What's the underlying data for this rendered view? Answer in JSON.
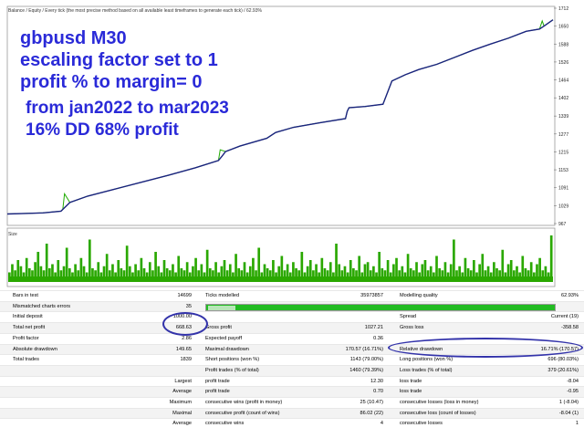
{
  "legend": "Balance / Equity / Every tick (the most precise method based on all available least timeframes to generate each tick) / 62.93%",
  "overlay": {
    "line1": "gbpusd M30",
    "line2": "escaling factor set to 1",
    "line3": "profit % to margin=  0",
    "line4": "from jan2022 to mar2023",
    "line5": "16% DD 68% profit"
  },
  "chart_data": [
    {
      "type": "line",
      "title": "",
      "series": [
        {
          "name": "Balance",
          "color": "#1a237e",
          "x": [
            0,
            20,
            40,
            60,
            62,
            70,
            90,
            120,
            150,
            180,
            210,
            236,
            240,
            244,
            260,
            290,
            300,
            320,
            350,
            378,
            380,
            382,
            400,
            420,
            425,
            430,
            445,
            460,
            480,
            500,
            520,
            540,
            560,
            580,
            595,
            600,
            610
          ],
          "y": [
            1000,
            1002,
            1004,
            1010,
            1016,
            1040,
            1062,
            1086,
            1110,
            1134,
            1160,
            1185,
            1200,
            1216,
            1235,
            1262,
            1282,
            1300,
            1316,
            1330,
            1355,
            1368,
            1372,
            1380,
            1420,
            1460,
            1482,
            1500,
            1518,
            1542,
            1566,
            1588,
            1608,
            1632,
            1640,
            1650,
            1672
          ]
        },
        {
          "name": "Equity",
          "color": "#1faa00",
          "x": [
            0,
            20,
            40,
            60,
            62,
            64,
            70,
            90,
            120,
            150,
            180,
            210,
            236,
            238,
            244,
            260,
            290,
            300,
            320,
            350,
            378,
            380,
            382,
            400,
            420,
            425,
            430,
            445,
            460,
            480,
            500,
            520,
            540,
            560,
            580,
            595,
            598,
            600,
            610
          ],
          "y": [
            1000,
            1002,
            1004,
            1010,
            1016,
            1070,
            1040,
            1062,
            1086,
            1110,
            1134,
            1160,
            1185,
            1222,
            1216,
            1235,
            1262,
            1282,
            1300,
            1316,
            1330,
            1355,
            1368,
            1372,
            1380,
            1420,
            1460,
            1482,
            1500,
            1518,
            1542,
            1566,
            1588,
            1608,
            1632,
            1640,
            1668,
            1650,
            1672
          ]
        }
      ],
      "y_ticks": [
        "1712",
        "1650",
        "1588",
        "1526",
        "1464",
        "1402",
        "1339",
        "1277",
        "1215",
        "1153",
        "1091",
        "1029",
        "967"
      ],
      "ylim": [
        967,
        1712
      ],
      "grid": false
    },
    {
      "type": "bar",
      "title": "Size",
      "color": "#2aa800",
      "values": [
        2,
        6,
        3,
        8,
        5,
        2,
        9,
        4,
        3,
        7,
        12,
        5,
        3,
        16,
        4,
        6,
        2,
        8,
        3,
        5,
        14,
        4,
        2,
        6,
        3,
        9,
        5,
        2,
        18,
        4,
        3,
        7,
        2,
        5,
        11,
        3,
        6,
        2,
        8,
        4,
        3,
        15,
        5,
        2,
        6,
        3,
        9,
        4,
        2,
        7,
        3,
        12,
        5,
        2,
        8,
        4,
        3,
        6,
        2,
        10,
        4,
        3,
        7,
        2,
        5,
        9,
        3,
        6,
        2,
        13,
        4,
        3,
        7,
        2,
        5,
        8,
        3,
        6,
        2,
        11,
        4,
        3,
        7,
        2,
        5,
        9,
        3,
        14,
        2,
        6,
        4,
        3,
        8,
        2,
        5,
        10,
        3,
        6,
        2,
        7,
        4,
        3,
        12,
        2,
        5,
        8,
        3,
        6,
        2,
        9,
        4,
        3,
        7,
        2,
        16,
        6,
        3,
        5,
        2,
        8,
        4,
        3,
        10,
        2,
        6,
        7,
        3,
        5,
        2,
        12,
        4,
        3,
        8,
        2,
        6,
        9,
        3,
        5,
        2,
        11,
        4,
        3,
        7,
        2,
        6,
        8,
        3,
        5,
        2,
        10,
        4,
        3,
        7,
        2,
        6,
        18,
        3,
        5,
        2,
        9,
        4,
        3,
        8,
        2,
        6,
        11,
        3,
        5,
        2,
        7,
        4,
        3,
        13,
        2,
        6,
        8,
        3,
        5,
        2,
        10,
        4,
        3,
        7,
        2,
        6,
        9,
        3,
        5,
        2,
        20
      ]
    }
  ],
  "report": {
    "bars_label": "Bars in test",
    "bars_value": "14699",
    "ticks_label": "Ticks modelled",
    "ticks_value": "35973857",
    "mq_label": "Modelling quality",
    "mq_value": "62.93%",
    "mismatch_label": "Mismatched charts errors",
    "mismatch_value": "35",
    "deposit_label": "Initial deposit",
    "deposit_value": "1000.00",
    "spread_label": "Spread",
    "spread_value": "Current (19)",
    "netprofit_label": "Total net profit",
    "netprofit_value": "668.63",
    "grossprofit_label": "Gross profit",
    "grossprofit_value": "1027.21",
    "grossloss_label": "Gross loss",
    "grossloss_value": "-358.58",
    "pf_label": "Profit factor",
    "pf_value": "2.86",
    "ep_label": "Expected payoff",
    "ep_value": "0.36",
    "absdd_label": "Absolute drawdown",
    "absdd_value": "149.65",
    "maxdd_label": "Maximal drawdown",
    "maxdd_value": "170.57 (16.71%)",
    "reldd_label": "Relative drawdown",
    "reldd_value": "16.71% (170.57)",
    "trades_label": "Total trades",
    "trades_value": "1839",
    "short_label": "Short positions (won %)",
    "short_value": "1143 (79.00%)",
    "long_label": "Long positions (won %)",
    "long_value": "696 (80.03%)",
    "profit_trades_label": "Profit trades (% of total)",
    "profit_trades_value": "1460 (79.39%)",
    "loss_trades_label": "Loss trades (% of total)",
    "loss_trades_value": "379 (20.61%)",
    "largest_label": "Largest",
    "largest_profit_label": "profit trade",
    "largest_profit_value": "12.30",
    "largest_loss_label": "loss trade",
    "largest_loss_value": "-8.04",
    "average_label": "Average",
    "average_profit_label": "profit trade",
    "average_profit_value": "0.70",
    "average_loss_label": "loss trade",
    "average_loss_value": "-0.95",
    "maximum_label": "Maximum",
    "max_wins_label": "consecutive wins (profit in money)",
    "max_wins_value": "25 (10.47)",
    "max_losses_label": "consecutive losses (loss in money)",
    "max_losses_value": "1 (-8.04)",
    "maximal_label": "Maximal",
    "maximal_profit_label": "consecutive profit (count of wins)",
    "maximal_profit_value": "86.02 (22)",
    "maximal_loss_label": "consecutive loss (count of losses)",
    "maximal_loss_value": "-8.04 (1)",
    "avg_label": "Average",
    "avg_wins_label": "consecutive wins",
    "avg_wins_value": "4",
    "avg_losses_label": "consecutive losses",
    "avg_losses_value": "1"
  }
}
